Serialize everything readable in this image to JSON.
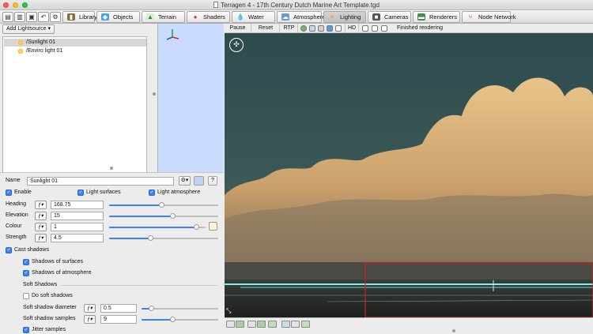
{
  "window": {
    "title": "Terragen 4 - 17th Century Dutch Marine Art Template.tgd"
  },
  "toolbar": {
    "tabs": [
      {
        "label": "Library",
        "icon": "library-icon",
        "color": "#6b4a2a"
      },
      {
        "label": "Objects",
        "icon": "cube-icon",
        "color": "#3a8fd6"
      },
      {
        "label": "Terrain",
        "icon": "terrain-icon",
        "color": "#3aa24a"
      },
      {
        "label": "Shaders",
        "icon": "shader-ball-icon",
        "color": "#d43a3a"
      },
      {
        "label": "Water",
        "icon": "water-drop-icon",
        "color": "#2a7ae0"
      },
      {
        "label": "Atmosphere",
        "icon": "atmosphere-icon",
        "color": "#5a8fc8"
      },
      {
        "label": "Lighting",
        "icon": "sun-icon",
        "color": "#f0a020"
      },
      {
        "label": "Cameras",
        "icon": "camera-icon",
        "color": "#555555"
      },
      {
        "label": "Renderers",
        "icon": "renderer-icon",
        "color": "#3a6a3a"
      },
      {
        "label": "Node Network",
        "icon": "node-network-icon",
        "color": "#c83a2a"
      }
    ]
  },
  "left": {
    "add_button": "Add Lightsource",
    "lights": [
      {
        "label": "/Sunlight 01",
        "selected": true
      },
      {
        "label": "/Enviro light 01",
        "selected": false
      }
    ],
    "name_label": "Name",
    "name_value": "Sunlight 01",
    "help_label": "?",
    "enable_label": "Enable",
    "light_surfaces_label": "Light surfaces",
    "light_atmosphere_label": "Light atmosphere",
    "heading_label": "Heading",
    "heading_value": "168.75",
    "heading_slider": 0.48,
    "elevation_label": "Elevation",
    "elevation_value": "15",
    "elevation_slider": 0.58,
    "colour_label": "Colour",
    "colour_value": "1",
    "colour_slider": 0.9,
    "colour_swatch": "#fff4cc",
    "strength_label": "Strength",
    "strength_value": "4.5",
    "strength_slider": 0.38,
    "cast_shadows_label": "Cast shadows",
    "shadows_surfaces_label": "Shadows of surfaces",
    "shadows_atmosphere_label": "Shadows of atmosphere",
    "soft_shadows_heading": "Soft Shadows",
    "do_soft_shadows_label": "Do soft shadows",
    "soft_diameter_label": "Soft shadow diameter",
    "soft_diameter_value": "0.5",
    "soft_diameter_slider": 0.12,
    "soft_samples_label": "Soft shadow samples",
    "soft_samples_value": "9",
    "soft_samples_slider": 0.4,
    "jitter_label": "Jitter samples"
  },
  "render": {
    "pause": "Pause",
    "reset": "Reset",
    "rtp": "RTP",
    "hd": "HD",
    "status": "Finished rendering"
  },
  "colors": {
    "accent": "#3b82f6",
    "render_region": "#d02020",
    "water_line": "#7ef0e6"
  }
}
